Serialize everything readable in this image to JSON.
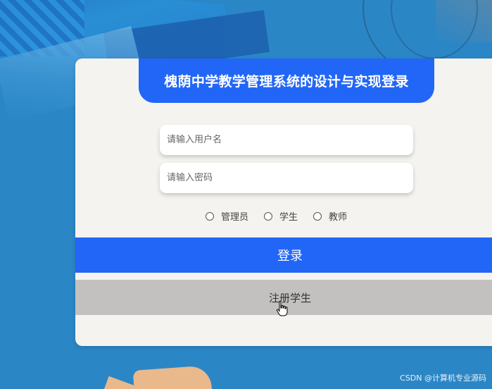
{
  "login": {
    "title": "槐荫中学教学管理系统的设计与实现登录",
    "username_placeholder": "请输入用户名",
    "password_placeholder": "请输入密码",
    "roles": [
      "管理员",
      "学生",
      "教师"
    ],
    "login_button": "登录",
    "register_button": "注册学生"
  },
  "watermark": "CSDN @计算机专业源码",
  "colors": {
    "accent": "#2166f6",
    "background": "#2b86c6",
    "card": "#f5f3ef",
    "register_button": "#c2c1c0"
  },
  "icons": {
    "cursor": "hand-pointer-icon"
  }
}
